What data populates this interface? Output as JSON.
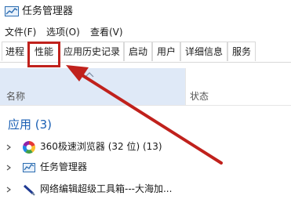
{
  "window": {
    "title": "任务管理器"
  },
  "menu": [
    "文件(F)",
    "选项(O)",
    "查看(V)"
  ],
  "tabs": [
    {
      "label": "进程"
    },
    {
      "label": "性能"
    },
    {
      "label": "应用历史记录"
    },
    {
      "label": "启动"
    },
    {
      "label": "用户"
    },
    {
      "label": "详细信息"
    },
    {
      "label": "服务"
    }
  ],
  "active_tab": "进程",
  "annotation": {
    "highlighted_tab": "性能",
    "color": "#c0211c"
  },
  "columns": {
    "name": "名称",
    "status": "状态"
  },
  "group": {
    "title": "应用 (3)"
  },
  "apps": [
    {
      "label": "360极速浏览器 (32 位) (13)",
      "icon": "browser-icon"
    },
    {
      "label": "任务管理器",
      "icon": "task-manager-icon"
    },
    {
      "label": "网络编辑超级工具箱---大海加...",
      "icon": "pen-icon"
    }
  ],
  "colors": {
    "header_bg": "#dfe9f7",
    "group_title": "#1a5fb4"
  }
}
